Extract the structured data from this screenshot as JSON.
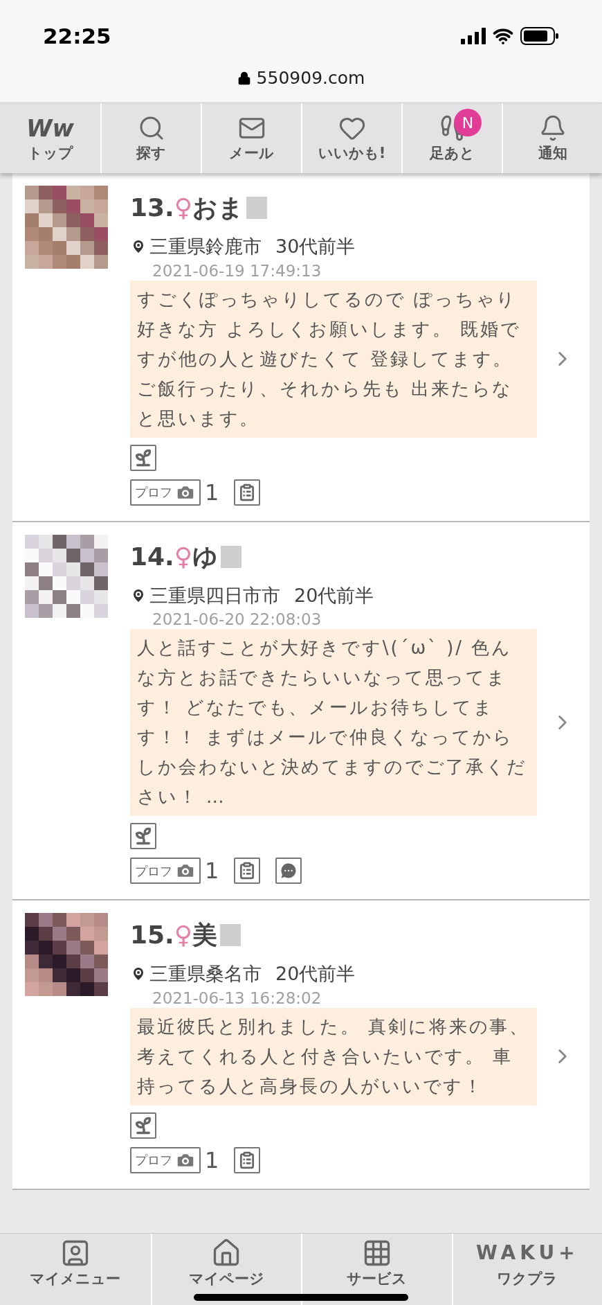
{
  "status_bar": {
    "time": "22:25"
  },
  "address_bar": {
    "url": "550909.com"
  },
  "nav_tabs": [
    {
      "kind": "logo",
      "logo_text": "Ww",
      "label": "トップ"
    },
    {
      "kind": "search",
      "label": "探す"
    },
    {
      "kind": "mail",
      "label": "メール"
    },
    {
      "kind": "heart",
      "label": "いいかも!"
    },
    {
      "kind": "footprints",
      "label": "足あと",
      "badge": "N"
    },
    {
      "kind": "bell",
      "label": "通知"
    }
  ],
  "profiles": [
    {
      "number": "13.",
      "gender": "♀",
      "name": "おま",
      "location": "三重県鈴鹿市",
      "age": "30代前半",
      "date": "2021-06-19 17:49:13",
      "message": "すごくぽっちゃりしてるので ぽっちゃり好きな方 よろしくお願いします。 既婚ですが他の人と遊びたくて 登録してます。ご飯行ったり、それから先も 出来たらなと思います。",
      "profile_label": "プロフ",
      "photo_count": "1",
      "chat": false
    },
    {
      "number": "14.",
      "gender": "♀",
      "name": "ゆ",
      "location": "三重県四日市市",
      "age": "20代前半",
      "date": "2021-06-20 22:08:03",
      "message": "人と話すことが大好きです\\(´ω` )/ 色んな方とお話できたらいいなって思ってます！ どなたでも、メールお待ちしてます！！ まずはメールで仲良くなってからしか会わないと決めてますのでご了承ください！ …",
      "profile_label": "プロフ",
      "photo_count": "1",
      "chat": true
    },
    {
      "number": "15.",
      "gender": "♀",
      "name": "美",
      "location": "三重県桑名市",
      "age": "20代前半",
      "date": "2021-06-13 16:28:02",
      "message": "最近彼氏と別れました。 真剣に将来の事、考えてくれる人と付き合いたいです。 車持ってる人と高身長の人がいいです！",
      "profile_label": "プロフ",
      "photo_count": "1",
      "chat": false
    }
  ],
  "bottom_nav": [
    {
      "kind": "user",
      "label": "マイメニュー"
    },
    {
      "kind": "home",
      "label": "マイページ"
    },
    {
      "kind": "grid",
      "label": "サービス"
    },
    {
      "kind": "logo",
      "logo_text": "WAKU+",
      "label": "ワクプラ"
    }
  ]
}
